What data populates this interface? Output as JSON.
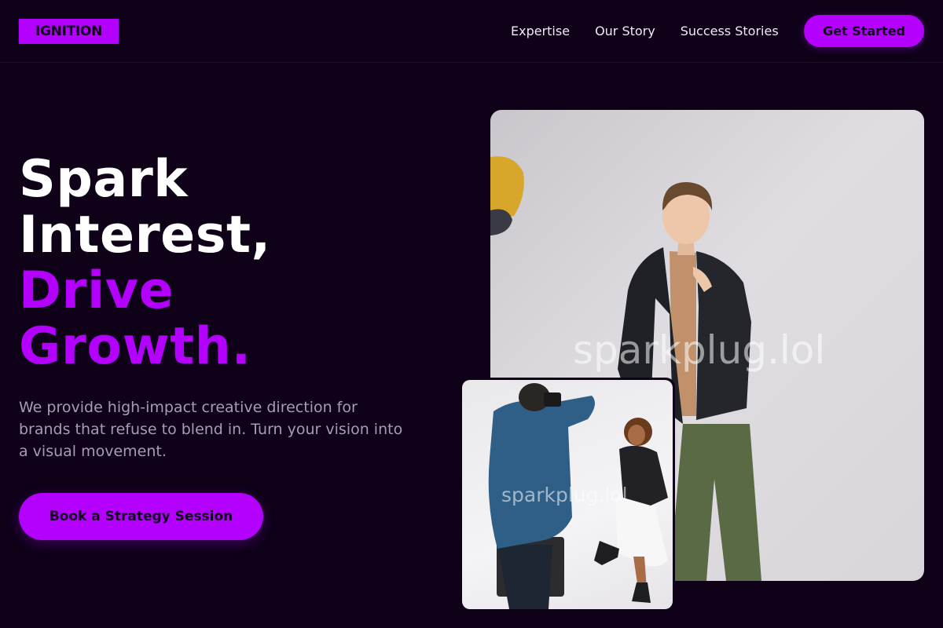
{
  "brand": {
    "logo_text": "IGNITION",
    "accent_color": "#b300ff",
    "background_color": "#0e0118"
  },
  "nav": {
    "links": [
      "Expertise",
      "Our Story",
      "Success Stories"
    ],
    "cta_label": "Get Started"
  },
  "hero": {
    "headline_lines": [
      "Spark",
      "Interest,"
    ],
    "headline_accent_lines": [
      "Drive",
      "Growth."
    ],
    "lede": "We provide high-impact creative direction for brands that refuse to blend in. Turn your vision into a visual movement.",
    "cta_label": "Book a Strategy Session"
  },
  "images": {
    "main_watermark": "sparkplug.lol",
    "inset_watermark": "sparkplug.lol"
  }
}
